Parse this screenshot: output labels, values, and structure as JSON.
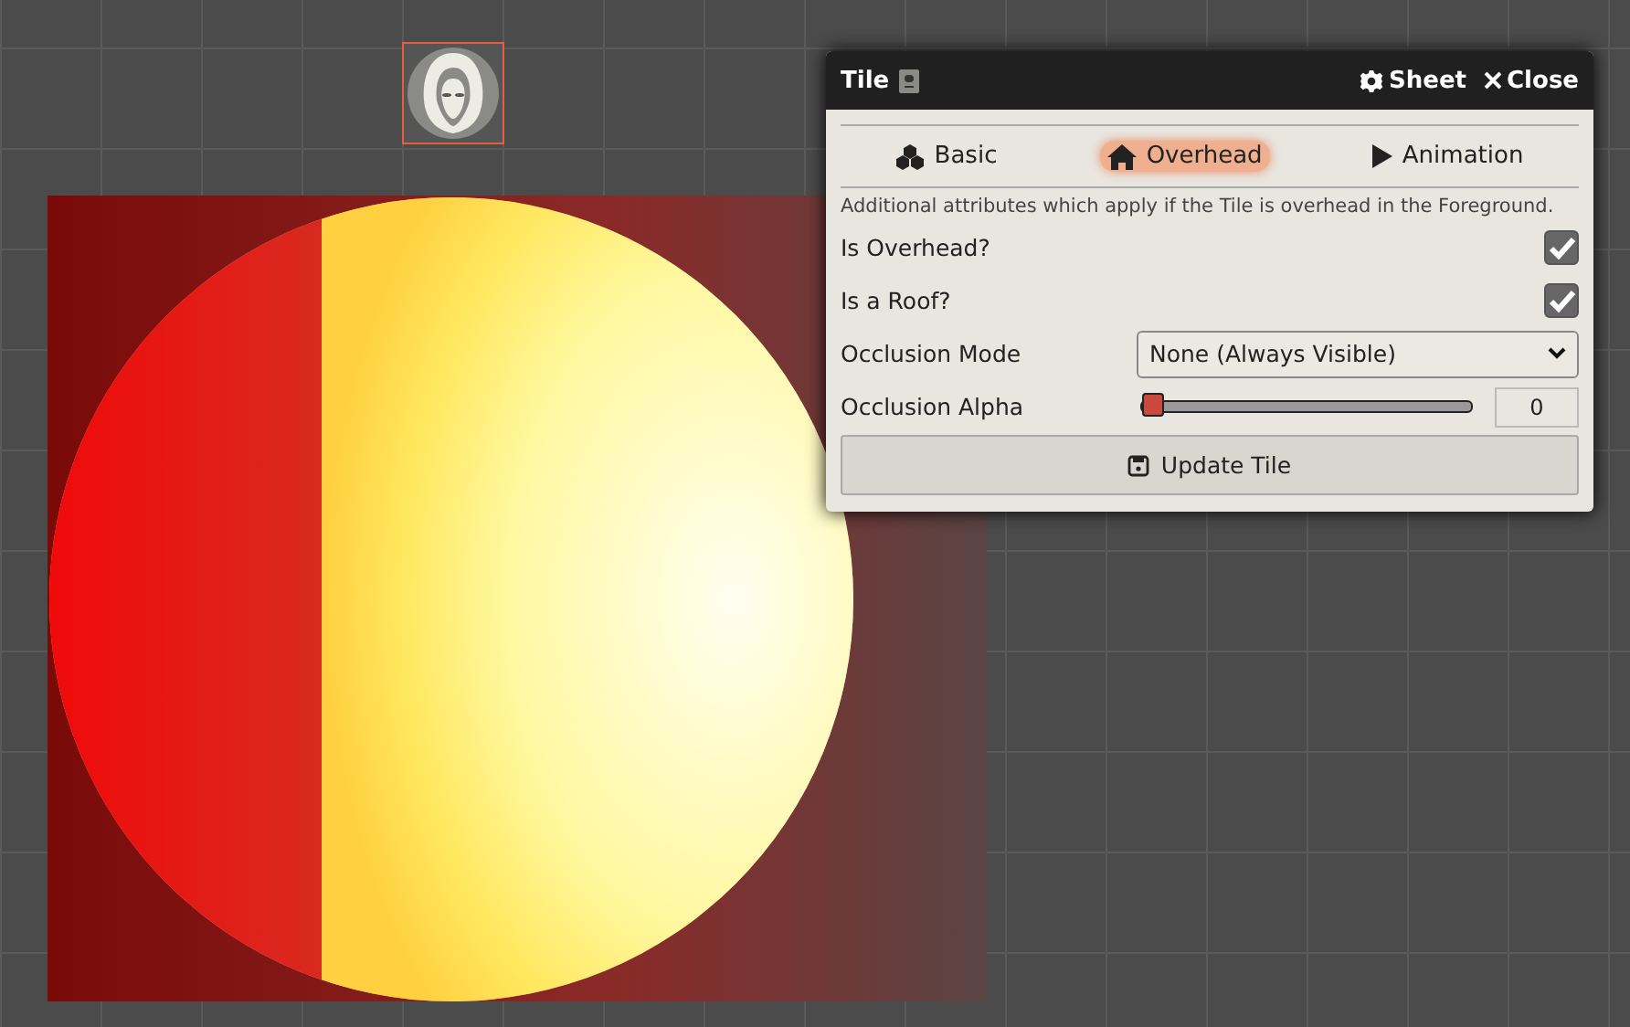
{
  "window": {
    "title": "Tile",
    "header_buttons": [
      {
        "label": "Sheet"
      },
      {
        "label": "Close"
      }
    ]
  },
  "tabs": [
    {
      "label": "Basic",
      "selected": false
    },
    {
      "label": "Overhead",
      "selected": true
    },
    {
      "label": "Animation",
      "selected": false
    }
  ],
  "hint": "Additional attributes which apply if the Tile is overhead in the Foreground.",
  "fields": [
    {
      "kind": "checkbox",
      "label": "Is Overhead?",
      "checked": true
    },
    {
      "kind": "checkbox",
      "label": "Is a Roof?",
      "checked": true
    },
    {
      "kind": "select",
      "label": "Occlusion Mode",
      "value": "None (Always Visible)"
    },
    {
      "kind": "range",
      "label": "Occlusion Alpha",
      "level": 0,
      "reading": "0"
    }
  ],
  "submit": {
    "label": "Update Tile"
  }
}
